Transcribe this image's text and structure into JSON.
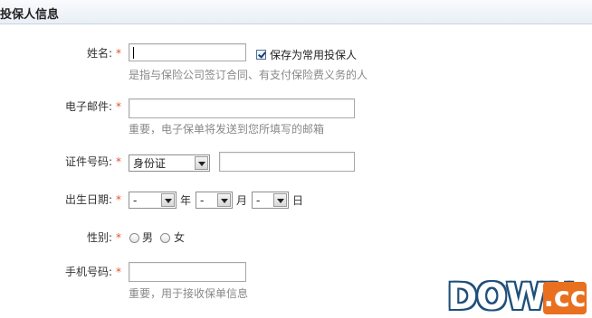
{
  "section": {
    "title": "投保人信息"
  },
  "form": {
    "name": {
      "label": "姓名:",
      "required": "*",
      "value": "",
      "save_checkbox_label": "保存为常用投保人",
      "hint": "是指与保险公司签订合同、有支付保险费义务的人"
    },
    "email": {
      "label": "电子邮件:",
      "required": "*",
      "value": "",
      "hint": "重要，电子保单将发送到您所填写的邮箱"
    },
    "id": {
      "label": "证件号码:",
      "required": "*",
      "type_selected": "身份证",
      "value": ""
    },
    "birth": {
      "label": "出生日期:",
      "required": "*",
      "year_value": "-",
      "year_unit": "年",
      "month_value": "-",
      "month_unit": "月",
      "day_value": "-",
      "day_unit": "日"
    },
    "gender": {
      "label": "性别:",
      "required": "*",
      "male": "男",
      "female": "女"
    },
    "phone": {
      "label": "手机号码:",
      "required": "*",
      "value": "",
      "hint": "重要，用于接收保单信息"
    }
  },
  "watermark": {
    "brand": "DOWN",
    "suffix": ".cc"
  }
}
